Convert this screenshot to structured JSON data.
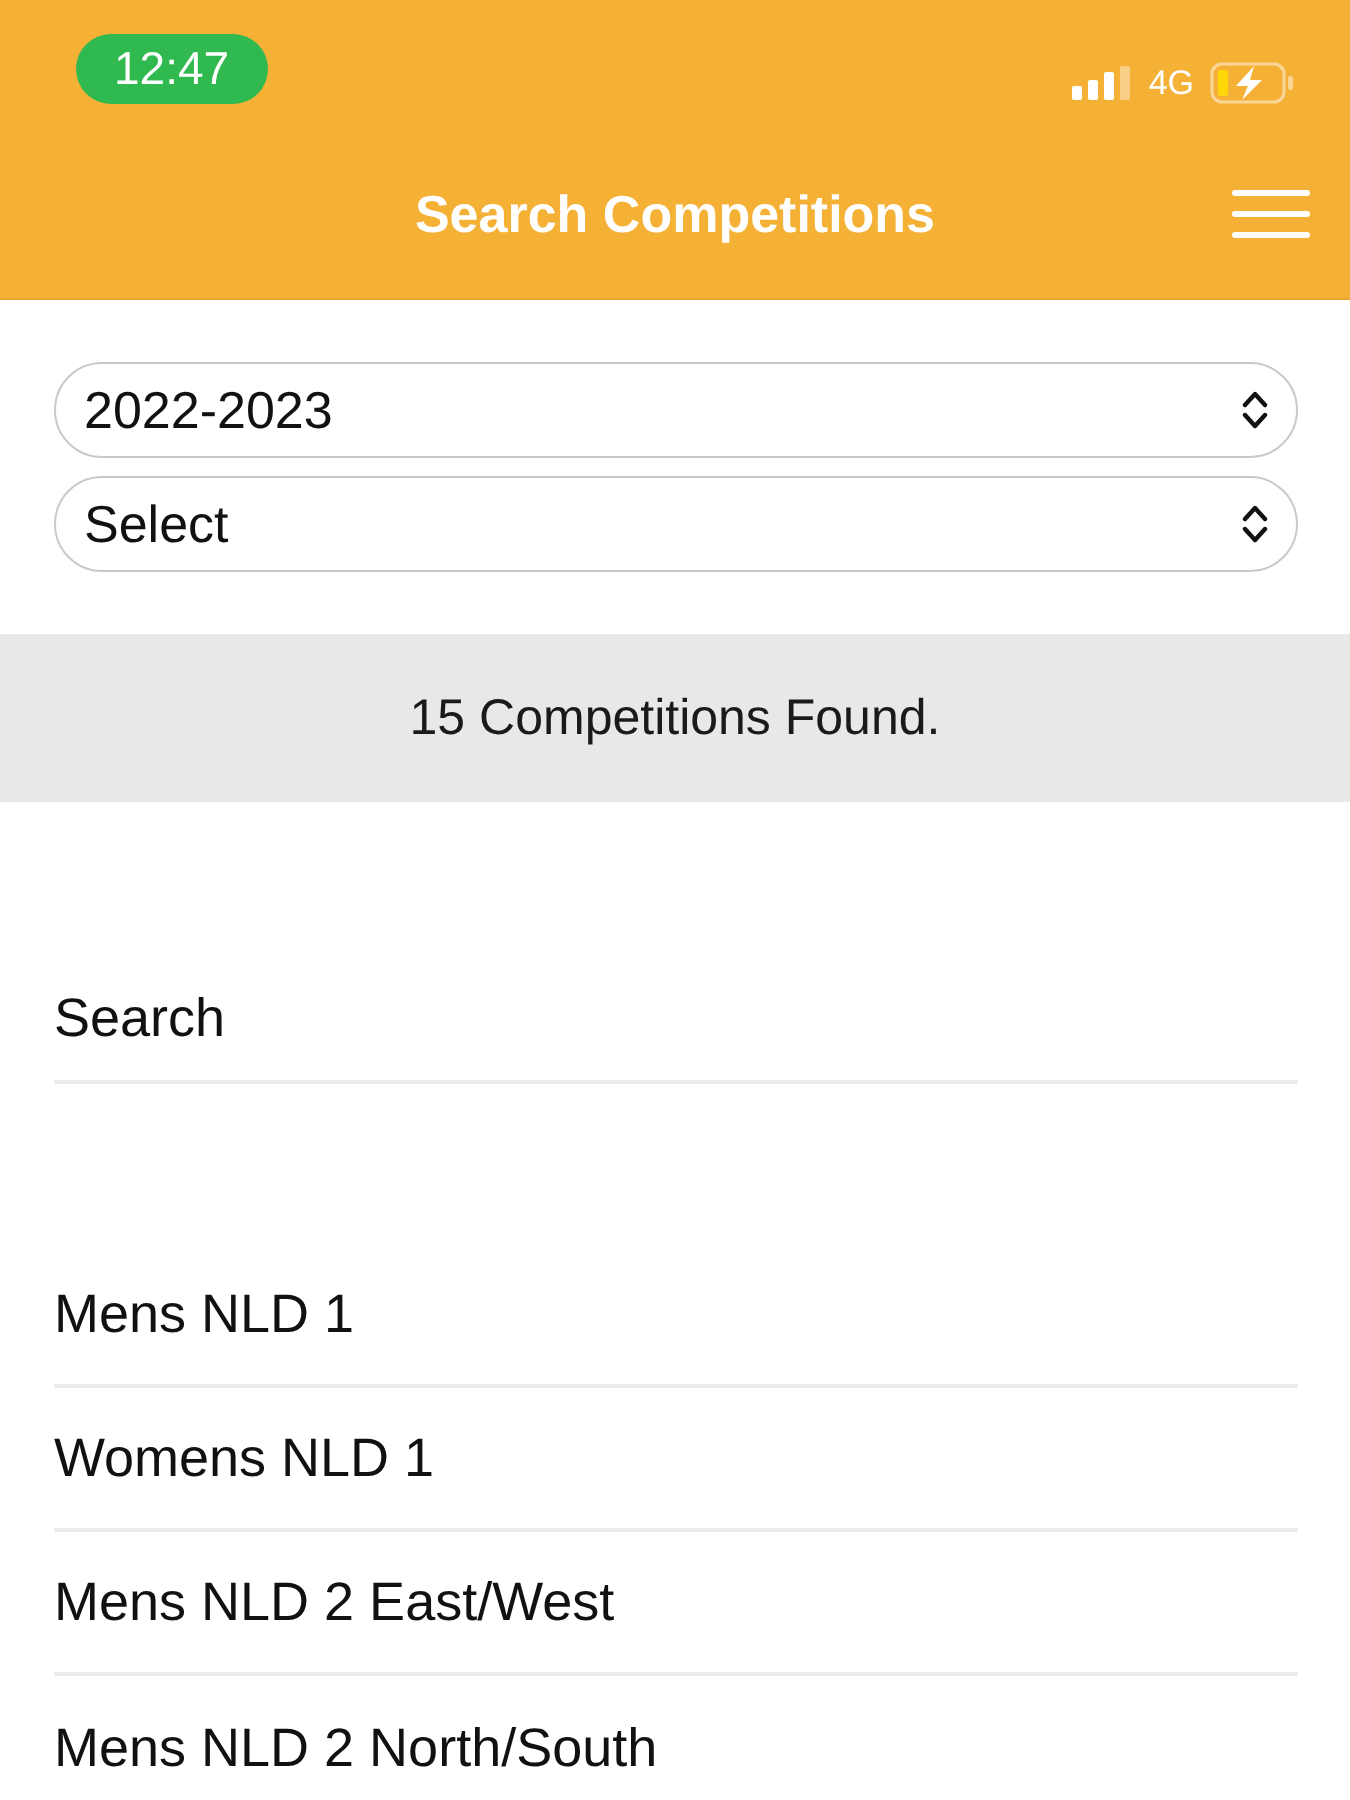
{
  "status_bar": {
    "time": "12:47",
    "network": "4G",
    "battery": {
      "charging": true
    }
  },
  "header": {
    "title": "Search Competitions"
  },
  "filters": [
    {
      "value": "2022-2023"
    },
    {
      "value": "Select"
    }
  ],
  "result_banner": "15 Competitions Found.",
  "search": {
    "placeholder": "Search"
  },
  "competitions": [
    {
      "name": "Mens NLD 1"
    },
    {
      "name": "Womens NLD 1"
    },
    {
      "name": "Mens NLD 2 East/West"
    },
    {
      "name": "Mens NLD 2 North/South"
    }
  ]
}
